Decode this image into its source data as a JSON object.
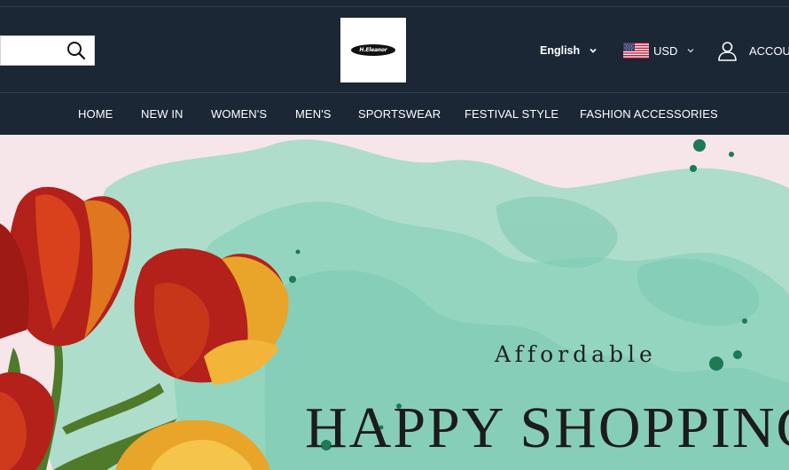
{
  "search": {
    "value": "",
    "placeholder": "",
    "icon": "search-icon"
  },
  "logo": {
    "text": "H.Eleanor"
  },
  "header": {
    "language_label": "English",
    "currency_label": "USD",
    "currency_flag": "us-flag-icon",
    "account_label": "ACCOUNT"
  },
  "nav": {
    "items": [
      {
        "label": "HOME"
      },
      {
        "label": "NEW IN"
      },
      {
        "label": "WOMEN'S"
      },
      {
        "label": "MEN'S"
      },
      {
        "label": "SPORTSWEAR"
      },
      {
        "label": "FESTIVAL STYLE"
      },
      {
        "label": "FASHION ACCESSORIES"
      }
    ]
  },
  "banner": {
    "kicker": "Affordable",
    "headline": "HAPPY SHOPPING"
  },
  "colors": {
    "header_bg": "#1b2735",
    "banner_bg": "#f6e6ea",
    "watercolor": "#8fd3be",
    "tulip_red": "#b3211a",
    "tulip_yellow": "#e8a52a"
  }
}
